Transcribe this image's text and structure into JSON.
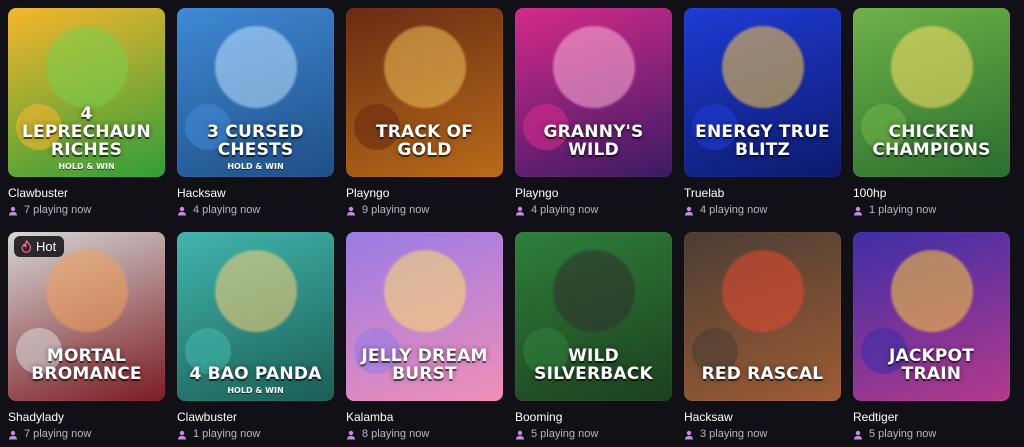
{
  "games": [
    {
      "id": "g1",
      "provider": "Clawbuster",
      "playing": "7 playing now",
      "title": "4 Leprechaun Riches",
      "subtitle": "HOLD & WIN",
      "bg": [
        "#f6b62b",
        "#2f9e3a"
      ],
      "blob": "#7ad24f"
    },
    {
      "id": "g2",
      "provider": "Hacksaw",
      "playing": "4 playing now",
      "title": "3 Cursed Chests",
      "subtitle": "HOLD & WIN",
      "bg": [
        "#3f89d6",
        "#1f4f86"
      ],
      "blob": "#bfe3ff"
    },
    {
      "id": "g3",
      "provider": "Playngo",
      "playing": "9 playing now",
      "title": "Track of Gold",
      "subtitle": "",
      "bg": [
        "#6a2b12",
        "#b86b1a"
      ],
      "blob": "#f2c35a"
    },
    {
      "id": "g4",
      "provider": "Playngo",
      "playing": "4 playing now",
      "title": "Granny's Wild",
      "subtitle": "",
      "bg": [
        "#d52a8a",
        "#3a1a65"
      ],
      "blob": "#ffb3d9"
    },
    {
      "id": "g5",
      "provider": "Truelab",
      "playing": "4 playing now",
      "title": "Energy True Blitz",
      "subtitle": "",
      "bg": [
        "#1f3bd6",
        "#0c1a6b"
      ],
      "blob": "#ffcc44"
    },
    {
      "id": "g6",
      "provider": "100hp",
      "playing": "1 playing now",
      "title": "Chicken Champions",
      "subtitle": "",
      "bg": [
        "#6fb248",
        "#2a6e2f"
      ],
      "blob": "#ffe066"
    },
    {
      "id": "g7",
      "provider": "Shadylady",
      "playing": "7 playing now",
      "title": "Mortal Bromance",
      "subtitle": "",
      "bg": [
        "#d6d6d6",
        "#7b1c22"
      ],
      "blob": "#f2a25a",
      "badge": "Hot"
    },
    {
      "id": "g8",
      "provider": "Clawbuster",
      "playing": "1 playing now",
      "title": "4 Bao Panda",
      "subtitle": "HOLD & WIN",
      "bg": [
        "#41b6ad",
        "#1b5e55"
      ],
      "blob": "#ffd27a"
    },
    {
      "id": "g9",
      "provider": "Kalamba",
      "playing": "8 playing now",
      "title": "Jelly Dream Burst",
      "subtitle": "",
      "bg": [
        "#9a7be6",
        "#f08fb7"
      ],
      "blob": "#ffe26b"
    },
    {
      "id": "g10",
      "provider": "Booming",
      "playing": "5 playing now",
      "title": "Wild Silverback",
      "subtitle": "",
      "bg": [
        "#2f7f3b",
        "#1c3f1d"
      ],
      "blob": "#2e2e2e"
    },
    {
      "id": "g11",
      "provider": "Hacksaw",
      "playing": "3 playing now",
      "title": "Red Rascal",
      "subtitle": "",
      "bg": [
        "#4b3d33",
        "#9e5c35"
      ],
      "blob": "#e84a2f"
    },
    {
      "id": "g12",
      "provider": "Redtiger",
      "playing": "5 playing now",
      "title": "Jackpot Train",
      "subtitle": "",
      "bg": [
        "#3d2ea6",
        "#b43a8b"
      ],
      "blob": "#ffcf3a"
    }
  ]
}
